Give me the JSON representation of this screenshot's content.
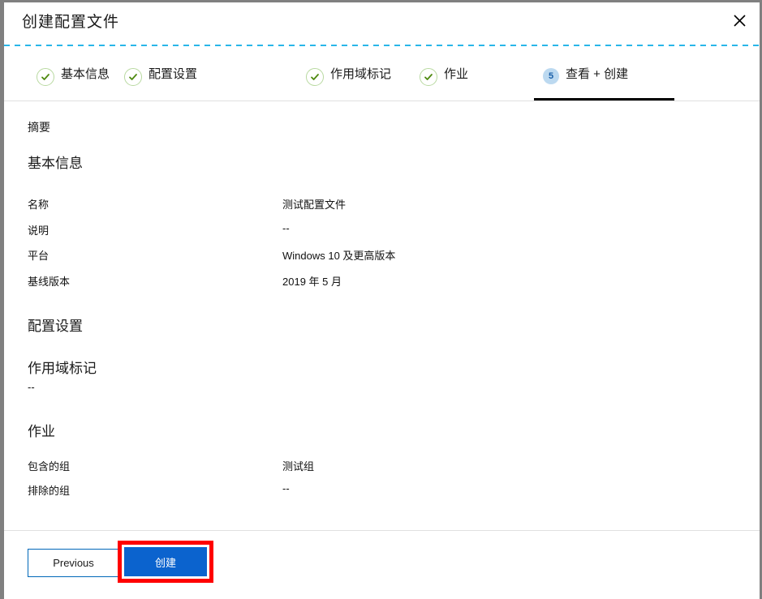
{
  "window": {
    "title": "创建配置文件",
    "close_icon": "close-icon"
  },
  "steps": [
    {
      "id": "basics",
      "label": "基本信息",
      "state": "done",
      "marker": "check-icon"
    },
    {
      "id": "settings",
      "label": "配置设置",
      "state": "done",
      "marker": "check-icon"
    },
    {
      "id": "scope",
      "label": "作用域标记",
      "state": "done",
      "marker": "check-icon"
    },
    {
      "id": "assign",
      "label": "作业",
      "state": "done",
      "marker": "check-icon"
    },
    {
      "id": "review",
      "label": "查看 + 创建",
      "state": "current",
      "marker": "5"
    }
  ],
  "content": {
    "summary_title": "摘要",
    "sections": [
      {
        "heading": "基本信息",
        "rows": [
          {
            "label": "名称",
            "value": "测试配置文件"
          },
          {
            "label": "说明",
            "value": "--"
          },
          {
            "label": "平台",
            "value": "Windows 10 及更高版本"
          },
          {
            "label": "基线版本",
            "value": "2019 年 5 月"
          }
        ]
      },
      {
        "heading": "配置设置",
        "rows": []
      },
      {
        "heading": "作用域标记",
        "plain_value": "--",
        "rows": []
      },
      {
        "heading": "作业",
        "rows": [
          {
            "label": "包含的组",
            "value": "测试组"
          },
          {
            "label": "排除的组",
            "value": "--"
          }
        ]
      }
    ]
  },
  "footer": {
    "previous_label": "Previous",
    "create_label": "创建"
  },
  "colors": {
    "accent_blue": "#0b63ce",
    "previous_border": "#0067b8",
    "step_done_green": "#4f8a10",
    "step_current_blue": "#bcd9f0",
    "dashed_line": "#29b6e8",
    "annotation_red": "#ff0000",
    "frame_gray": "#808080"
  }
}
